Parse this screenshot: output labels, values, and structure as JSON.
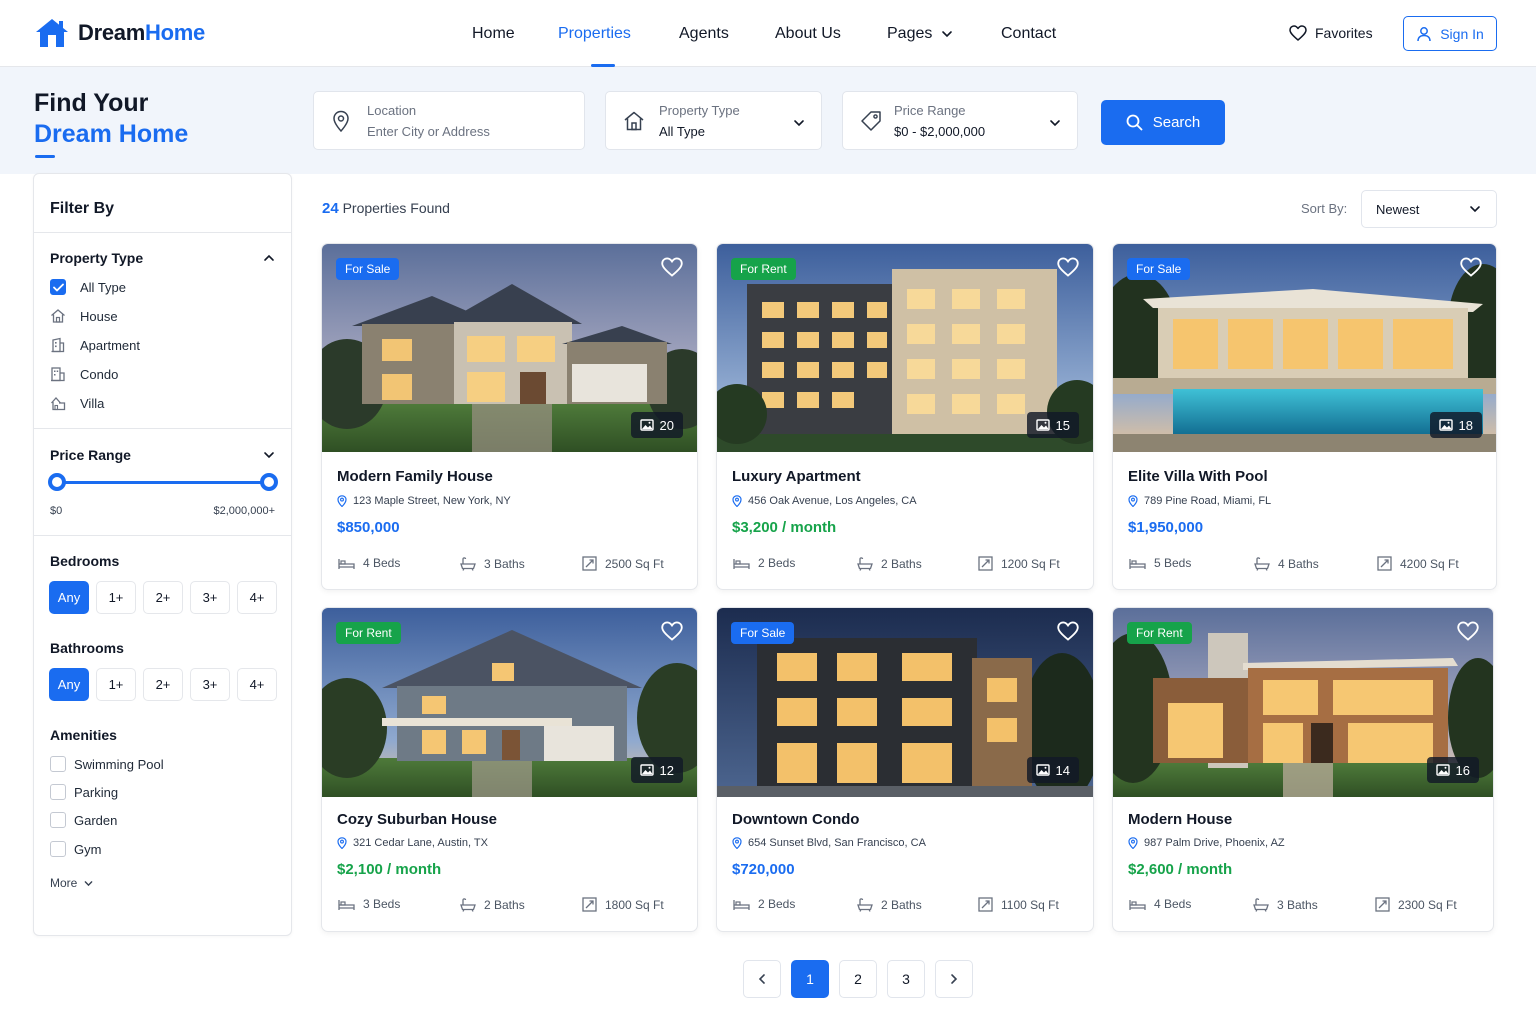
{
  "header": {
    "brand_a": "Dream",
    "brand_b": "Home",
    "nav": [
      {
        "label": "Home"
      },
      {
        "label": "Properties"
      },
      {
        "label": "Agents"
      },
      {
        "label": "About Us"
      },
      {
        "label": "Pages"
      },
      {
        "label": "Contact"
      }
    ],
    "favorites_label": "Favorites",
    "signin_label": "Sign In"
  },
  "hero": {
    "title_line1": "Find Your",
    "title_line2": "Dream Home",
    "location_label": "Location",
    "location_placeholder": "Enter City or Address",
    "type_label": "Property Type",
    "type_value": "All Type",
    "price_label": "Price Range",
    "price_value": "$0 - $2,000,000",
    "search_label": "Search"
  },
  "filter": {
    "title": "Filter By",
    "property_type_label": "Property Type",
    "types": [
      "All Type",
      "House",
      "Apartment",
      "Condo",
      "Villa"
    ],
    "price_range_label": "Price Range",
    "price_min": "$0",
    "price_max": "$2,000,000+",
    "price_slider_min_fraction": 0,
    "price_slider_max_fraction": 1,
    "bedrooms_label": "Bedrooms",
    "bathrooms_label": "Bathrooms",
    "room_options": [
      "Any",
      "1+",
      "2+",
      "3+",
      "4+"
    ],
    "amenities_label": "Amenities",
    "amenities": [
      "Swimming Pool",
      "Parking",
      "Garden",
      "Gym"
    ],
    "more_label": "More"
  },
  "results": {
    "count": "24",
    "found_label": "Properties Found",
    "sort_label": "Sort By:",
    "sort_value": "Newest"
  },
  "listings": [
    {
      "status": "For Sale",
      "photos": "20",
      "title": "Modern Family House",
      "address": "123 Maple Street, New York, NY",
      "price": "$850,000",
      "beds": "4 Beds",
      "baths": "3 Baths",
      "area": "2500 Sq Ft"
    },
    {
      "status": "For Rent",
      "photos": "15",
      "title": "Luxury Apartment",
      "address": "456 Oak Avenue, Los Angeles, CA",
      "price": "$3,200 / month",
      "beds": "2 Beds",
      "baths": "2 Baths",
      "area": "1200 Sq Ft"
    },
    {
      "status": "For Sale",
      "photos": "18",
      "title": "Elite Villa With Pool",
      "address": "789 Pine Road, Miami, FL",
      "price": "$1,950,000",
      "beds": "5 Beds",
      "baths": "4 Baths",
      "area": "4200 Sq Ft"
    },
    {
      "status": "For Rent",
      "photos": "12",
      "title": "Cozy Suburban House",
      "address": "321 Cedar Lane, Austin, TX",
      "price": "$2,100 / month",
      "beds": "3 Beds",
      "baths": "2 Baths",
      "area": "1800 Sq Ft"
    },
    {
      "status": "For Sale",
      "photos": "14",
      "title": "Downtown Condo",
      "address": "654 Sunset Blvd, San Francisco, CA",
      "price": "$720,000",
      "beds": "2 Beds",
      "baths": "2 Baths",
      "area": "1100 Sq Ft"
    },
    {
      "status": "For Rent",
      "photos": "16",
      "title": "Modern House",
      "address": "987 Palm Drive, Phoenix, AZ",
      "price": "$2,600 / month",
      "beds": "4 Beds",
      "baths": "3 Baths",
      "area": "2300 Sq Ft"
    }
  ],
  "pagination": {
    "pages": [
      "1",
      "2",
      "3"
    ],
    "current": "1"
  },
  "colors": {
    "accent": "#1a6cf0",
    "rent": "#16a34a",
    "hero_bg": "#f1f5fb"
  }
}
